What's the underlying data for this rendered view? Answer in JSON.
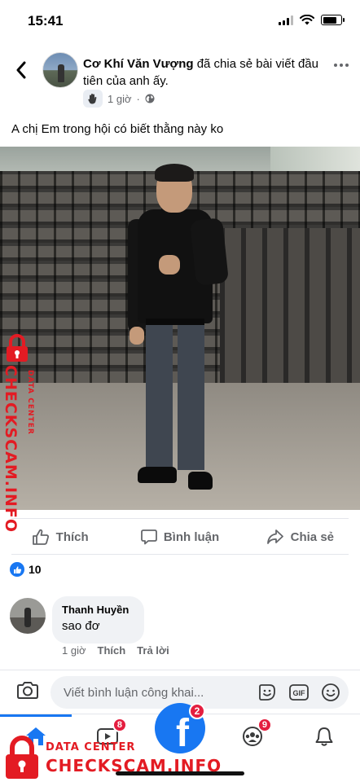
{
  "status_bar": {
    "time": "15:41",
    "battery_level": 0.8
  },
  "post": {
    "author": "Cơ Khí Văn Vượng",
    "action_text": " đã chia sẻ bài viết đầu tiên của anh ấy.",
    "time": "1 giờ",
    "dot": "·",
    "text": "A chị Em trong hội có biết thằng này ko",
    "icons": {
      "back": "back-arrow-icon",
      "more": "more-dots-icon",
      "wave": "wave-hand-icon",
      "privacy": "globe-icon"
    }
  },
  "actions": {
    "like_label": "Thích",
    "comment_label": "Bình luận",
    "share_label": "Chia sẻ"
  },
  "reactions": {
    "count": "10"
  },
  "comment": {
    "author": "Thanh Huyền",
    "text": "sao đơ",
    "time": "1 giờ",
    "like_label": "Thích",
    "reply_label": "Trả lời"
  },
  "composer": {
    "placeholder": "Viết bình luận công khai...",
    "gif_label": "GIF"
  },
  "bottom_nav": {
    "video_badge": "8",
    "fb_logo_text": "f",
    "fb_badge": "2",
    "groups_badge": "9"
  },
  "watermark": {
    "line1": "DATA CENTER",
    "line2": "CHECKSCAM.INFO"
  },
  "colors": {
    "brand": "#1877f2",
    "badge": "#e41e3f",
    "watermark": "#e31b23"
  }
}
